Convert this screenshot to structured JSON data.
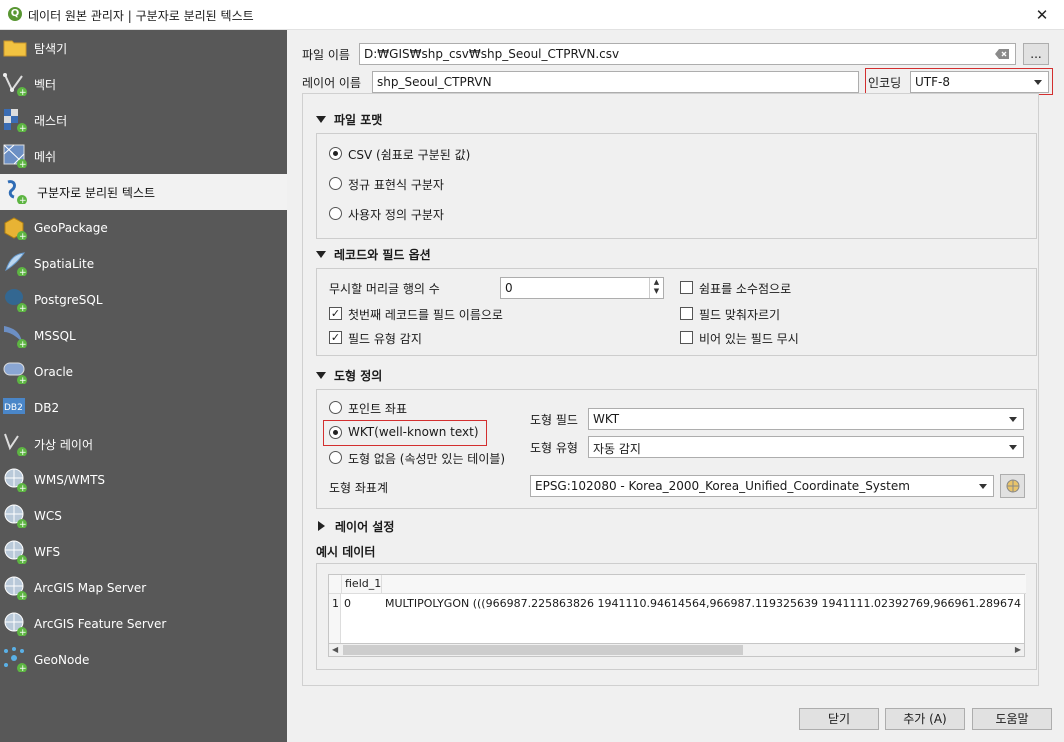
{
  "window": {
    "title": "데이터 원본 관리자 | 구분자로 분리된 텍스트",
    "close": "✕",
    "logo": "Q"
  },
  "sidebar": {
    "items": [
      {
        "label": "탐색기",
        "icon": "folder-icon"
      },
      {
        "label": "벡터",
        "icon": "vector-icon"
      },
      {
        "label": "래스터",
        "icon": "raster-icon"
      },
      {
        "label": "메쉬",
        "icon": "mesh-icon"
      },
      {
        "label": "구분자로 분리된 텍스트",
        "icon": "delimited-text-icon"
      },
      {
        "label": "GeoPackage",
        "icon": "geopackage-icon"
      },
      {
        "label": "SpatiaLite",
        "icon": "spatialite-icon"
      },
      {
        "label": "PostgreSQL",
        "icon": "postgresql-icon"
      },
      {
        "label": "MSSQL",
        "icon": "mssql-icon"
      },
      {
        "label": "Oracle",
        "icon": "oracle-icon"
      },
      {
        "label": "DB2",
        "icon": "db2-icon"
      },
      {
        "label": "가상 레이어",
        "icon": "virtual-layer-icon"
      },
      {
        "label": "WMS/WMTS",
        "icon": "wms-icon"
      },
      {
        "label": "WCS",
        "icon": "wcs-icon"
      },
      {
        "label": "WFS",
        "icon": "wfs-icon"
      },
      {
        "label": "ArcGIS Map Server",
        "icon": "arcgis-map-icon"
      },
      {
        "label": "ArcGIS Feature Server",
        "icon": "arcgis-feature-icon"
      },
      {
        "label": "GeoNode",
        "icon": "geonode-icon"
      }
    ]
  },
  "file": {
    "label": "파일 이름",
    "value": "D:₩GIS₩shp_csv₩shp_Seoul_CTPRVN.csv",
    "browse": "..."
  },
  "layer": {
    "label": "레이어 이름",
    "value": "shp_Seoul_CTPRVN"
  },
  "encoding": {
    "label": "인코딩",
    "value": "UTF-8"
  },
  "file_format": {
    "title": "파일 포맷",
    "options": [
      "CSV (쉼표로 구분된 값)",
      "정규 표현식 구분자",
      "사용자 정의 구분자"
    ]
  },
  "record": {
    "title": "레코드와 필드 옵션",
    "skip_label": "무시할 머리글 행의 수",
    "skip_value": "0",
    "first_record": "첫번째 레코드를 필드 이름으로",
    "detect_types": "필드 유형 감지",
    "decimal_comma": "쉼표를 소수점으로",
    "trim": "필드 맞춰자르기",
    "discard_empty": "비어 있는 필드 무시"
  },
  "geometry": {
    "title": "도형 정의",
    "options": [
      "포인트 좌표",
      "WKT(well-known text)",
      "도형 없음 (속성만 있는 테이블)"
    ],
    "field_label": "도형 필드",
    "field_value": "WKT",
    "type_label": "도형 유형",
    "type_value": "자동 감지",
    "crs_label": "도형 좌표계",
    "crs_value": "EPSG:102080 - Korea_2000_Korea_Unified_Coordinate_System"
  },
  "layer_settings": {
    "title": "레이어 설정"
  },
  "sample": {
    "title": "예시 데이터",
    "header": "field_1",
    "row_num": "1",
    "row_id": "0",
    "row_value": "MULTIPOLYGON (((966987.225863826 1941110.94614564,966987.119325639 1941111.02392769,966961.289674"
  },
  "buttons": {
    "close": "닫기",
    "add": "추가 (A)",
    "help": "도움말"
  }
}
